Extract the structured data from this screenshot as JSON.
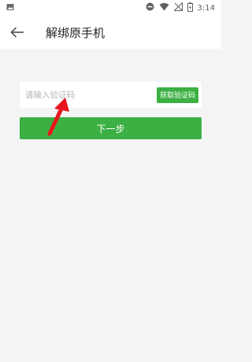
{
  "status_bar": {
    "time": "3:14",
    "icons": [
      "image-icon",
      "do-not-disturb-icon",
      "wifi-icon",
      "no-signal-icon",
      "battery-icon"
    ]
  },
  "app_bar": {
    "back_icon": "arrow-left-icon",
    "title": "解绑原手机"
  },
  "form": {
    "code_placeholder": "请输入验证码",
    "code_value": "",
    "get_code_label": "获取验证码",
    "next_label": "下一步"
  },
  "colors": {
    "accent": "#3cb043",
    "background": "#f4f4f4",
    "annotation_arrow": "#e8161c"
  }
}
